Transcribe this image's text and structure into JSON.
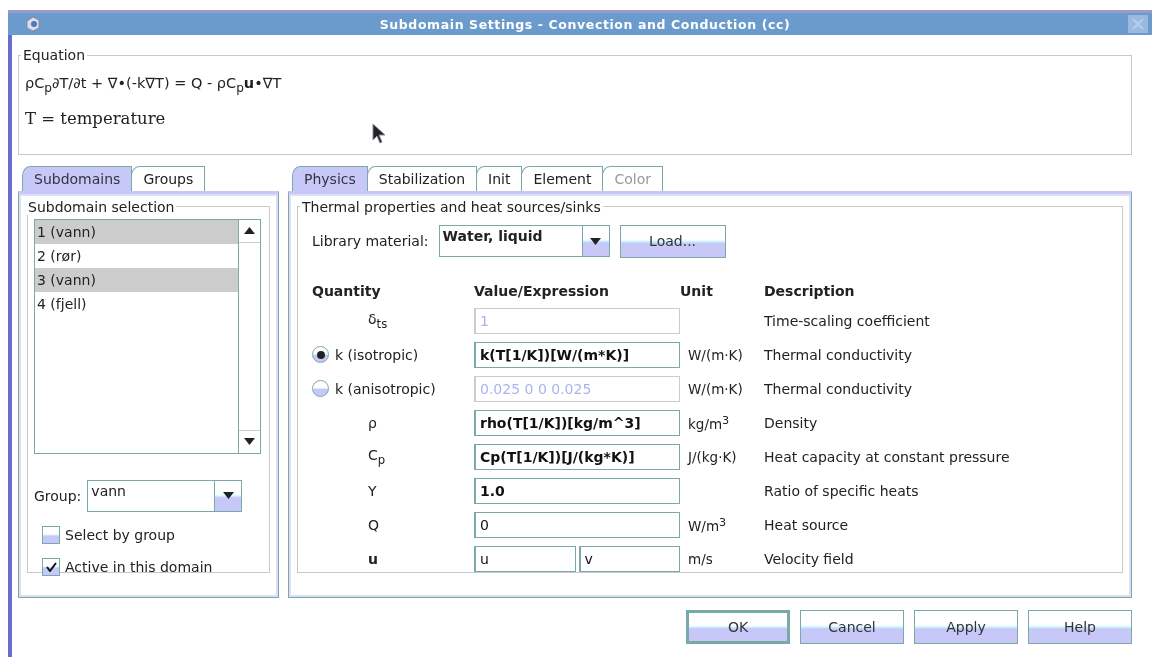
{
  "window": {
    "title": "Subdomain Settings - Convection and Conduction (cc)"
  },
  "equation": {
    "legend": "Equation",
    "formula": "ρC$_{p}$∂T/∂t + ∇•(-k∇T) = Q - ρC$_{p}$**u**•∇T",
    "variable": "T = temperature"
  },
  "left_tabs": [
    {
      "label": "Subdomains",
      "selected": true
    },
    {
      "label": "Groups",
      "selected": false
    }
  ],
  "subdomain_selection": {
    "legend": "Subdomain selection",
    "items": [
      {
        "label": "1 (vann)",
        "selected": true
      },
      {
        "label": "2 (rør)",
        "selected": false
      },
      {
        "label": "3 (vann)",
        "selected": true
      },
      {
        "label": "4 (fjell)",
        "selected": false
      }
    ],
    "group_label": "Group:",
    "group_value": "vann",
    "checkboxes": [
      {
        "label": "Select by group",
        "checked": false
      },
      {
        "label": "Active in this domain",
        "checked": true
      }
    ]
  },
  "right_tabs": [
    {
      "label": "Physics",
      "selected": true,
      "disabled": false
    },
    {
      "label": "Stabilization",
      "selected": false,
      "disabled": false
    },
    {
      "label": "Init",
      "selected": false,
      "disabled": false
    },
    {
      "label": "Element",
      "selected": false,
      "disabled": false
    },
    {
      "label": "Color",
      "selected": false,
      "disabled": true
    }
  ],
  "physics": {
    "legend": "Thermal properties and heat sources/sinks",
    "library_label": "Library material:",
    "library_value": "Water, liquid",
    "load_button": "Load...",
    "columns": [
      "Quantity",
      "Value/Expression",
      "Unit",
      "Description"
    ],
    "rows": [
      {
        "kind": "plain",
        "quantity": "δ$_{ts}$",
        "quantity_bold": false,
        "fields": [
          {
            "value": "1",
            "disabled": true,
            "bold": false
          }
        ],
        "description": "Time-scaling coefficient"
      },
      {
        "kind": "radio",
        "selected": true,
        "quantity": "k (isotropic)",
        "quantity_bold": false,
        "fields": [
          {
            "value": "k(T[1/K])[W/(m*K)]",
            "disabled": false,
            "bold": true
          }
        ],
        "unit": "W/(m·K)",
        "description": "Thermal conductivity"
      },
      {
        "kind": "radio",
        "selected": false,
        "quantity": "k (anisotropic)",
        "quantity_bold": false,
        "fields": [
          {
            "value": "0.025 0 0 0.025",
            "disabled": true,
            "bold": false
          }
        ],
        "unit": "W/(m·K)",
        "description": "Thermal conductivity"
      },
      {
        "kind": "plain",
        "quantity": "ρ",
        "quantity_bold": false,
        "fields": [
          {
            "value": "rho(T[1/K])[kg/m^3]",
            "disabled": false,
            "bold": true
          }
        ],
        "unit": "kg/m$^{3}$",
        "description": "Density"
      },
      {
        "kind": "plain",
        "quantity": "C$_{p}$",
        "quantity_bold": false,
        "fields": [
          {
            "value": "Cp(T[1/K])[J/(kg*K)]",
            "disabled": false,
            "bold": true
          }
        ],
        "unit": "J/(kg·K)",
        "description": "Heat capacity at constant pressure"
      },
      {
        "kind": "plain",
        "quantity": "Υ",
        "quantity_bold": false,
        "fields": [
          {
            "value": "1.0",
            "disabled": false,
            "bold": true
          }
        ],
        "description": "Ratio of specific heats"
      },
      {
        "kind": "plain",
        "quantity": "Q",
        "quantity_bold": false,
        "fields": [
          {
            "value": "0",
            "disabled": false,
            "bold": false
          }
        ],
        "unit": "W/m$^{3}$",
        "description": "Heat source"
      },
      {
        "kind": "plain",
        "quantity": "u",
        "quantity_bold": true,
        "fields": [
          {
            "value": "u",
            "disabled": false,
            "bold": false
          },
          {
            "value": "v",
            "disabled": false,
            "bold": false
          }
        ],
        "unit": "m/s",
        "description": "Velocity field"
      }
    ]
  },
  "buttons": [
    {
      "label": "OK",
      "default": true
    },
    {
      "label": "Cancel",
      "default": false
    },
    {
      "label": "Apply",
      "default": false
    },
    {
      "label": "Help",
      "default": false
    }
  ]
}
